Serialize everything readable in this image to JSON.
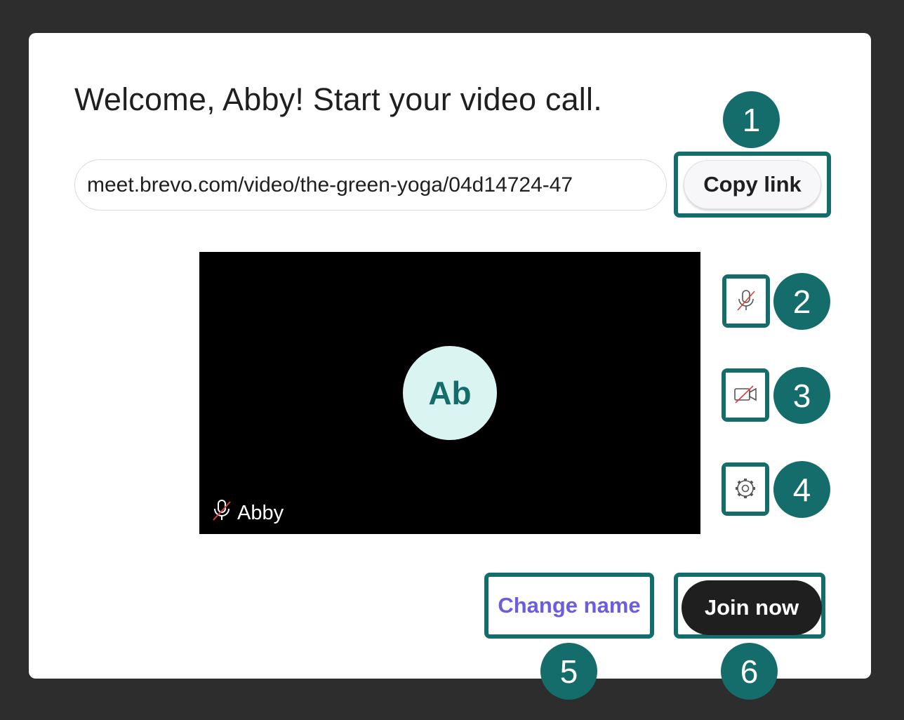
{
  "header": {
    "title": "Welcome, Abby! Start your video call."
  },
  "meeting_link": {
    "value": "meet.brevo.com/video/the-green-yoga/04d14724-47",
    "copy_label": "Copy link"
  },
  "preview": {
    "avatar_initials": "Ab",
    "participant_name": "Abby",
    "mic_status": "muted"
  },
  "controls": {
    "microphone": {
      "icon": "microphone-off-icon",
      "state": "off"
    },
    "camera": {
      "icon": "camera-off-icon",
      "state": "off"
    },
    "settings": {
      "icon": "gear-icon"
    }
  },
  "actions": {
    "change_name_label": "Change name",
    "join_label": "Join now"
  },
  "callouts": [
    "1",
    "2",
    "3",
    "4",
    "5",
    "6"
  ],
  "colors": {
    "teal": "#146d6a",
    "avatar_bg": "#daf4f2",
    "link_purple": "#6b5ce0",
    "join_bg": "#1f1f1f",
    "muted_red": "#e03c3c"
  }
}
